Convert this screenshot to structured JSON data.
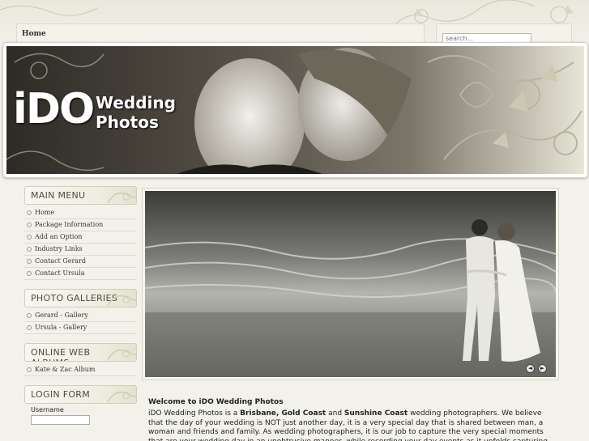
{
  "breadcrumb": {
    "home": "Home"
  },
  "search": {
    "placeholder": "search..."
  },
  "header": {
    "logo_main": "iDO",
    "logo_line1": "Wedding",
    "logo_line2": "Photos"
  },
  "sidebar": {
    "main_menu": {
      "title": "MAIN MENU",
      "items": [
        "Home",
        "Package Information",
        "Add an Option",
        "Industry Links",
        "Contact Gerard",
        "Contact Ursula"
      ]
    },
    "photo_galleries": {
      "title": "PHOTO GALLERIES",
      "items": [
        "Gerard - Gallery",
        "Ursula - Gallery"
      ]
    },
    "online_albums": {
      "title": "ONLINE WEB ALBUMS",
      "items": [
        "Kate & Zac Album"
      ]
    },
    "login": {
      "title": "LOGIN FORM",
      "username_label": "Username"
    }
  },
  "slideshow": {
    "prev_icon": "◄",
    "next_icon": "►"
  },
  "content": {
    "heading": "Welcome to iDO Wedding Photos",
    "p1_a": "iDO Wedding Photos is a ",
    "p1_b": "Brisbane",
    "p1_c": ", ",
    "p1_d": "Gold Coast",
    "p1_e": " and ",
    "p1_f": "Sunshine Coast",
    "p1_g": " wedding photographers.  We believe that the day of your wedding is NOT just another day, it is a very special day that is shared between man, a woman and friends and family.  As wedding photographers, it is our job to capture the very special moments that are your wedding day in an unobtrusive manner, while recording your day events as it unfolds capturing the flavour and the essence of your day."
  }
}
